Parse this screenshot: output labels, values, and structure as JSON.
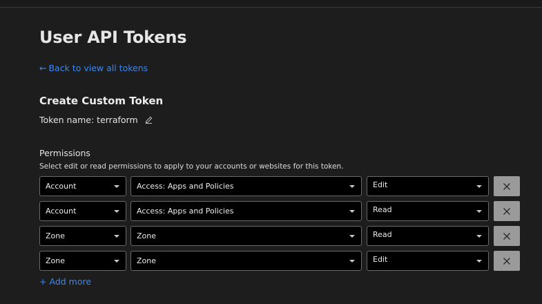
{
  "header": {
    "title": "User API Tokens",
    "back_arrow": "←",
    "back_link": "Back to view all tokens"
  },
  "create": {
    "title": "Create Custom Token",
    "token_name_label": "Token name: terraform",
    "edit_icon": "pencil-icon"
  },
  "permissions": {
    "label": "Permissions",
    "description": "Select edit or read permissions to apply to your accounts or websites for this token.",
    "rows": [
      {
        "scope": "Account",
        "resource": "Access: Apps and Policies",
        "level": "Edit"
      },
      {
        "scope": "Account",
        "resource": "Access: Apps and Policies",
        "level": "Read"
      },
      {
        "scope": "Zone",
        "resource": "Zone",
        "level": "Read"
      },
      {
        "scope": "Zone",
        "resource": "Zone",
        "level": "Edit"
      }
    ],
    "remove_icon": "close-icon",
    "add_more_plus": "+",
    "add_more": "Add more"
  },
  "colors": {
    "background": "#1d1d1d",
    "link": "#3a88f0",
    "select_bg": "#000000",
    "remove_button": "#9a9a9a"
  }
}
